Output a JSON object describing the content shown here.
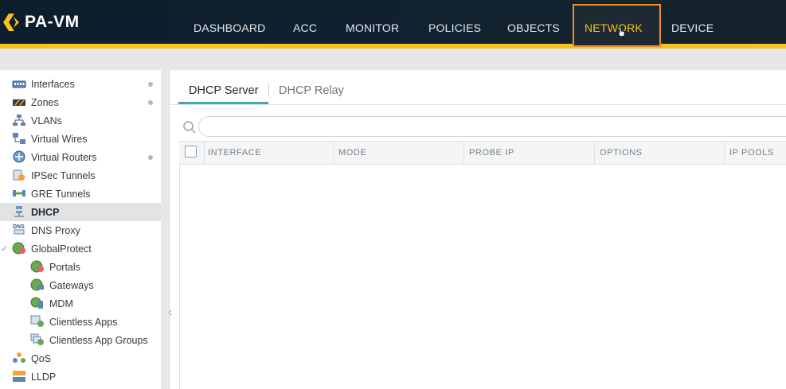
{
  "app": {
    "logo_text": "PA-VM"
  },
  "nav": {
    "items": [
      {
        "label": "DASHBOARD"
      },
      {
        "label": "ACC"
      },
      {
        "label": "MONITOR"
      },
      {
        "label": "POLICIES"
      },
      {
        "label": "OBJECTS"
      },
      {
        "label": "NETWORK",
        "active": true
      },
      {
        "label": "DEVICE"
      }
    ]
  },
  "sidebar": {
    "items": [
      {
        "label": "Interfaces",
        "icon": "interfaces-icon",
        "dot": true
      },
      {
        "label": "Zones",
        "icon": "zones-icon",
        "dot": true
      },
      {
        "label": "VLANs",
        "icon": "vlans-icon"
      },
      {
        "label": "Virtual Wires",
        "icon": "virtual-wires-icon"
      },
      {
        "label": "Virtual Routers",
        "icon": "virtual-routers-icon",
        "dot": true
      },
      {
        "label": "IPSec Tunnels",
        "icon": "ipsec-tunnels-icon"
      },
      {
        "label": "GRE Tunnels",
        "icon": "gre-tunnels-icon"
      },
      {
        "label": "DHCP",
        "icon": "dhcp-icon",
        "selected": true
      },
      {
        "label": "DNS Proxy",
        "icon": "dns-proxy-icon",
        "icon_text": "DNS"
      },
      {
        "label": "GlobalProtect",
        "icon": "globalprotect-icon",
        "expanded": true
      },
      {
        "label": "Portals",
        "icon": "portals-icon",
        "child": true
      },
      {
        "label": "Gateways",
        "icon": "gateways-icon",
        "child": true
      },
      {
        "label": "MDM",
        "icon": "mdm-icon",
        "child": true
      },
      {
        "label": "Clientless Apps",
        "icon": "clientless-apps-icon",
        "child": true
      },
      {
        "label": "Clientless App Groups",
        "icon": "clientless-app-groups-icon",
        "child": true
      },
      {
        "label": "QoS",
        "icon": "qos-icon"
      },
      {
        "label": "LLDP",
        "icon": "lldp-icon"
      }
    ]
  },
  "tabs": [
    {
      "label": "DHCP Server",
      "active": true
    },
    {
      "label": "DHCP Relay"
    }
  ],
  "search": {
    "value": "",
    "placeholder": ""
  },
  "table": {
    "columns": [
      "INTERFACE",
      "MODE",
      "PROBE IP",
      "OPTIONS",
      "IP POOLS"
    ],
    "rows": []
  },
  "colors": {
    "header_bg": "#0d1d2b",
    "accent_gold": "#f7c21a",
    "active_outline": "#f28c2a",
    "tab_underline": "#41a5b4"
  }
}
